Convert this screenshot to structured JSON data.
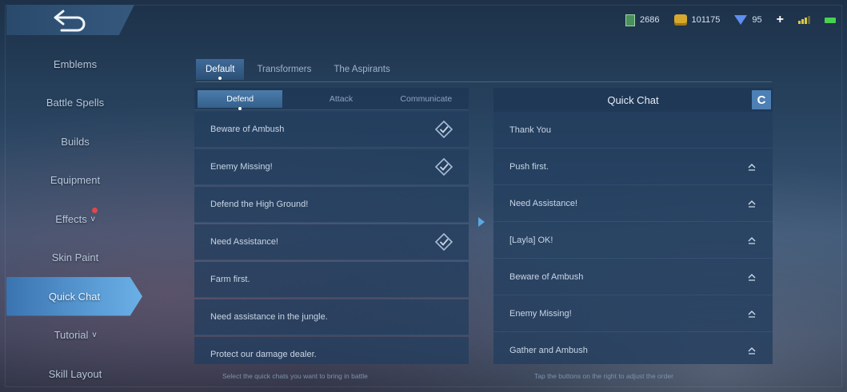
{
  "topbar": {
    "tickets": "2686",
    "battle_points": "101175",
    "diamonds": "95",
    "plus": "+"
  },
  "sidebar": {
    "items": [
      {
        "label": "Emblems"
      },
      {
        "label": "Battle Spells"
      },
      {
        "label": "Builds"
      },
      {
        "label": "Equipment"
      },
      {
        "label": "Effects",
        "chevron": "v"
      },
      {
        "label": "Skin Paint"
      },
      {
        "label": "Quick Chat",
        "active": true
      },
      {
        "label": "Tutorial",
        "chevron": "v"
      },
      {
        "label": "Skill Layout"
      }
    ]
  },
  "top_tabs": [
    "Default",
    "Transformers",
    "The Aspirants"
  ],
  "sub_tabs": [
    "Defend",
    "Attack",
    "Communicate"
  ],
  "left_messages": [
    {
      "text": "Beware of Ambush",
      "selected": true
    },
    {
      "text": "Enemy Missing!",
      "selected": true
    },
    {
      "text": "Defend the High Ground!",
      "selected": false
    },
    {
      "text": "Need Assistance!",
      "selected": true
    },
    {
      "text": "Farm first.",
      "selected": false
    },
    {
      "text": "Need assistance in the jungle.",
      "selected": false
    },
    {
      "text": "Protect our damage dealer.",
      "selected": false
    }
  ],
  "quick_chat": {
    "title": "Quick Chat",
    "refresh": "C",
    "items": [
      {
        "text": "Thank You",
        "arrow": false
      },
      {
        "text": "Push first.",
        "arrow": true
      },
      {
        "text": "Need Assistance!",
        "arrow": true
      },
      {
        "text": "[Layla] OK!",
        "arrow": true
      },
      {
        "text": "Beware of Ambush",
        "arrow": true
      },
      {
        "text": "Enemy Missing!",
        "arrow": true
      },
      {
        "text": "Gather and Ambush",
        "arrow": true
      }
    ]
  },
  "hints": {
    "left": "Select the quick chats you want to bring in battle",
    "right": "Tap the buttons on the right to adjust the order"
  },
  "colors": {
    "accent": "#5d9fd8",
    "panel": "#223e5e",
    "refresh": "#4d80b5"
  }
}
